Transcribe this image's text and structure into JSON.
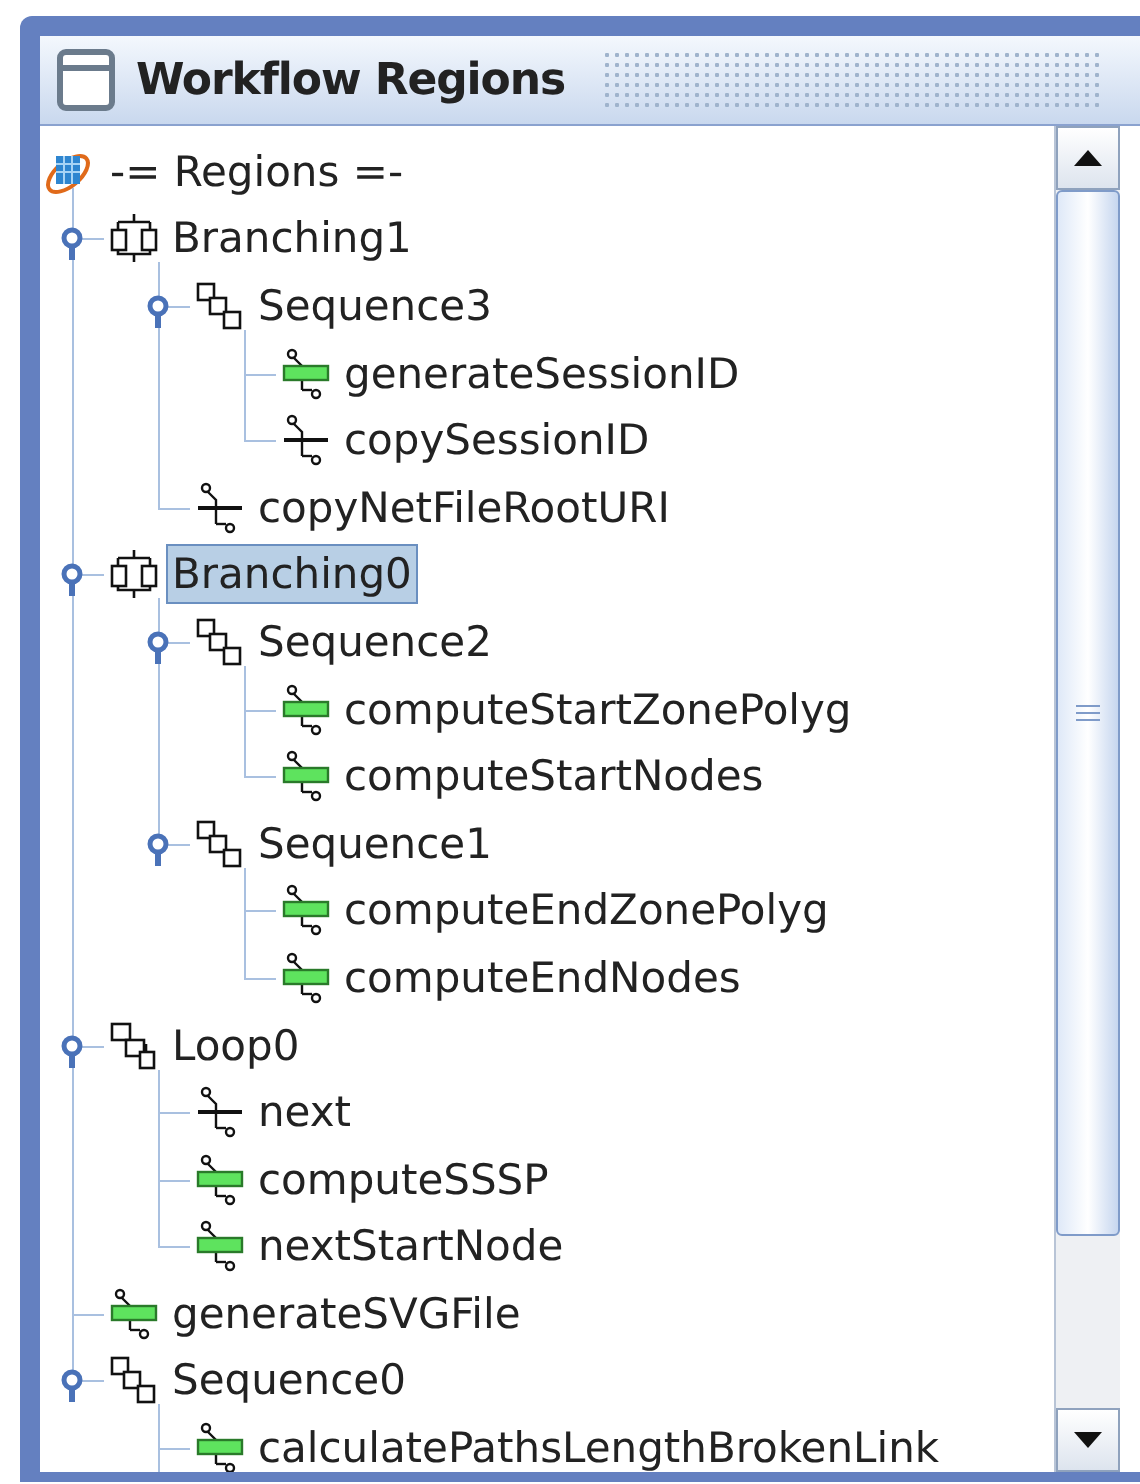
{
  "window": {
    "title": "Workflow Regions"
  },
  "tree": {
    "root": {
      "label": "-= Regions =-",
      "kind": "root",
      "selected": false
    },
    "children": [
      {
        "label": "Branching1",
        "kind": "branching",
        "expanded": true,
        "selected": false,
        "children": [
          {
            "label": "Sequence3",
            "kind": "sequence",
            "expanded": true,
            "selected": false,
            "children": [
              {
                "label": "generateSessionID",
                "kind": "task",
                "selected": false
              },
              {
                "label": "copySessionID",
                "kind": "copy",
                "selected": false
              }
            ]
          },
          {
            "label": "copyNetFileRootURI",
            "kind": "copy",
            "selected": false
          }
        ]
      },
      {
        "label": "Branching0",
        "kind": "branching",
        "expanded": true,
        "selected": true,
        "children": [
          {
            "label": "Sequence2",
            "kind": "sequence",
            "expanded": true,
            "selected": false,
            "children": [
              {
                "label": "computeStartZonePolyg",
                "kind": "task",
                "selected": false
              },
              {
                "label": "computeStartNodes",
                "kind": "task",
                "selected": false
              }
            ]
          },
          {
            "label": "Sequence1",
            "kind": "sequence",
            "expanded": true,
            "selected": false,
            "children": [
              {
                "label": "computeEndZonePolyg",
                "kind": "task",
                "selected": false
              },
              {
                "label": "computeEndNodes",
                "kind": "task",
                "selected": false
              }
            ]
          }
        ]
      },
      {
        "label": "Loop0",
        "kind": "loop",
        "expanded": true,
        "selected": false,
        "children": [
          {
            "label": "next",
            "kind": "copy",
            "selected": false
          },
          {
            "label": "computeSSSP",
            "kind": "task",
            "selected": false
          },
          {
            "label": "nextStartNode",
            "kind": "task",
            "selected": false
          }
        ]
      },
      {
        "label": "generateSVGFile",
        "kind": "task",
        "selected": false
      },
      {
        "label": "Sequence0",
        "kind": "sequence",
        "expanded": true,
        "selected": false,
        "children": [
          {
            "label": "calculatePathsLengthBrokenLink",
            "kind": "task",
            "selected": false
          }
        ]
      }
    ]
  }
}
